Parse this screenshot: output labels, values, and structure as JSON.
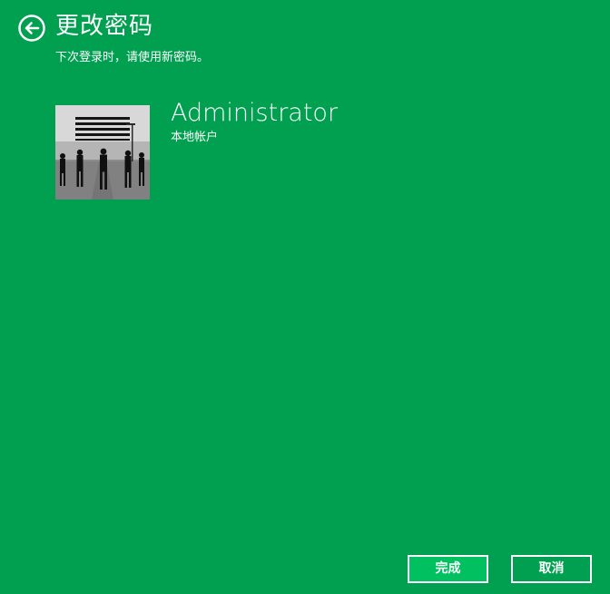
{
  "header": {
    "title": "更改密码",
    "subtitle": "下次登录时，请使用新密码。",
    "back_icon": "arrow-left-circle-icon"
  },
  "account": {
    "name": "Administrator",
    "type": "本地帐户",
    "avatar": "user-avatar-photo"
  },
  "footer": {
    "done_label": "完成",
    "cancel_label": "取消"
  },
  "colors": {
    "background": "#00a050",
    "done_button": "#00c060",
    "text": "#ffffff"
  }
}
